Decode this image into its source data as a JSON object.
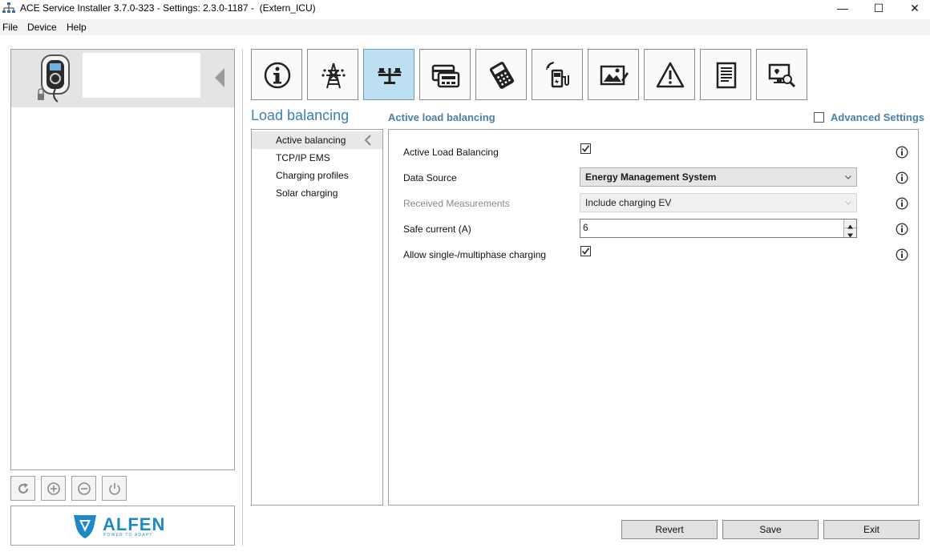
{
  "window": {
    "title": "ACE Service Installer 3.7.0-323 - Settings: 2.3.0-1187 -  (Extern_ICU)",
    "minimize_glyph": "—",
    "maximize_glyph": "☐",
    "close_glyph": "✕"
  },
  "menu": [
    "File",
    "Device",
    "Help"
  ],
  "logo": {
    "text": "ALFEN",
    "tagline": "POWER TO ADAPT",
    "color": "#1e88c8"
  },
  "tabs": [
    {
      "icon": "info-icon",
      "active": false
    },
    {
      "icon": "power-pylon-icon",
      "active": false
    },
    {
      "icon": "scale-balance-icon",
      "active": true
    },
    {
      "icon": "card-reader-icon",
      "active": false
    },
    {
      "icon": "payment-terminal-icon",
      "active": false
    },
    {
      "icon": "ev-charger-wireless-icon",
      "active": false
    },
    {
      "icon": "image-edit-icon",
      "active": false
    },
    {
      "icon": "warning-icon",
      "active": false
    },
    {
      "icon": "document-icon",
      "active": false
    },
    {
      "icon": "monitor-diagnostics-icon",
      "active": false
    }
  ],
  "section_title": "Load balancing",
  "panel_title": "Active load balancing",
  "advanced_settings": {
    "label": "Advanced Settings",
    "checked": false
  },
  "subnav": [
    {
      "label": "Active balancing",
      "active": true
    },
    {
      "label": "TCP/IP EMS",
      "active": false
    },
    {
      "label": "Charging profiles",
      "active": false
    },
    {
      "label": "Solar charging",
      "active": false
    }
  ],
  "fields": {
    "active_load_balancing": {
      "label": "Active Load Balancing",
      "checked": true
    },
    "data_source": {
      "label": "Data Source",
      "value": "Energy Management System"
    },
    "received_measurements": {
      "label": "Received Measurements",
      "value": "Include charging EV",
      "disabled": true
    },
    "safe_current": {
      "label": "Safe current (A)",
      "value": "6"
    },
    "allow_phase": {
      "label": "Allow single-/multiphase charging",
      "checked": true
    }
  },
  "buttons": {
    "revert": "Revert",
    "save": "Save",
    "exit": "Exit"
  },
  "colors": {
    "accent": "#3f7fb3",
    "active_tab": "#bcdff2",
    "logo": "#1e88c8"
  }
}
